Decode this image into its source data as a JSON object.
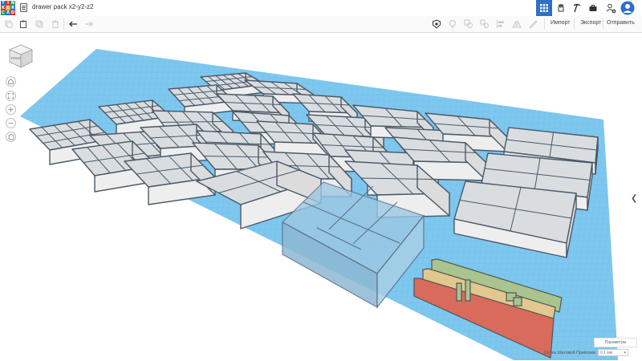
{
  "app": {
    "logo_letters": [
      "T",
      "I",
      "N",
      "K",
      "E",
      "R",
      "C",
      "A",
      "D"
    ]
  },
  "header": {
    "title": "drawer pack x2-y2-z2"
  },
  "toolbar": {
    "import_label": "Импорт",
    "export_label": "Экспорт",
    "send_label": "Отправить"
  },
  "viewcube": {
    "face_label": "FRONT"
  },
  "footer": {
    "settings_label": "Параметры",
    "grid_label": "Сетка Шаговой Привязки",
    "grid_value": "0,1 мм"
  },
  "colors": {
    "accent": "#2f6fc9",
    "plate": "#7ec7ee",
    "bin_wall": "#eeeeee",
    "outline": "#4a5968",
    "selected": "#a9cfe8",
    "divider_red": "#d86b5c",
    "divider_tan": "#e0c88e",
    "divider_green": "#a9c48f"
  }
}
